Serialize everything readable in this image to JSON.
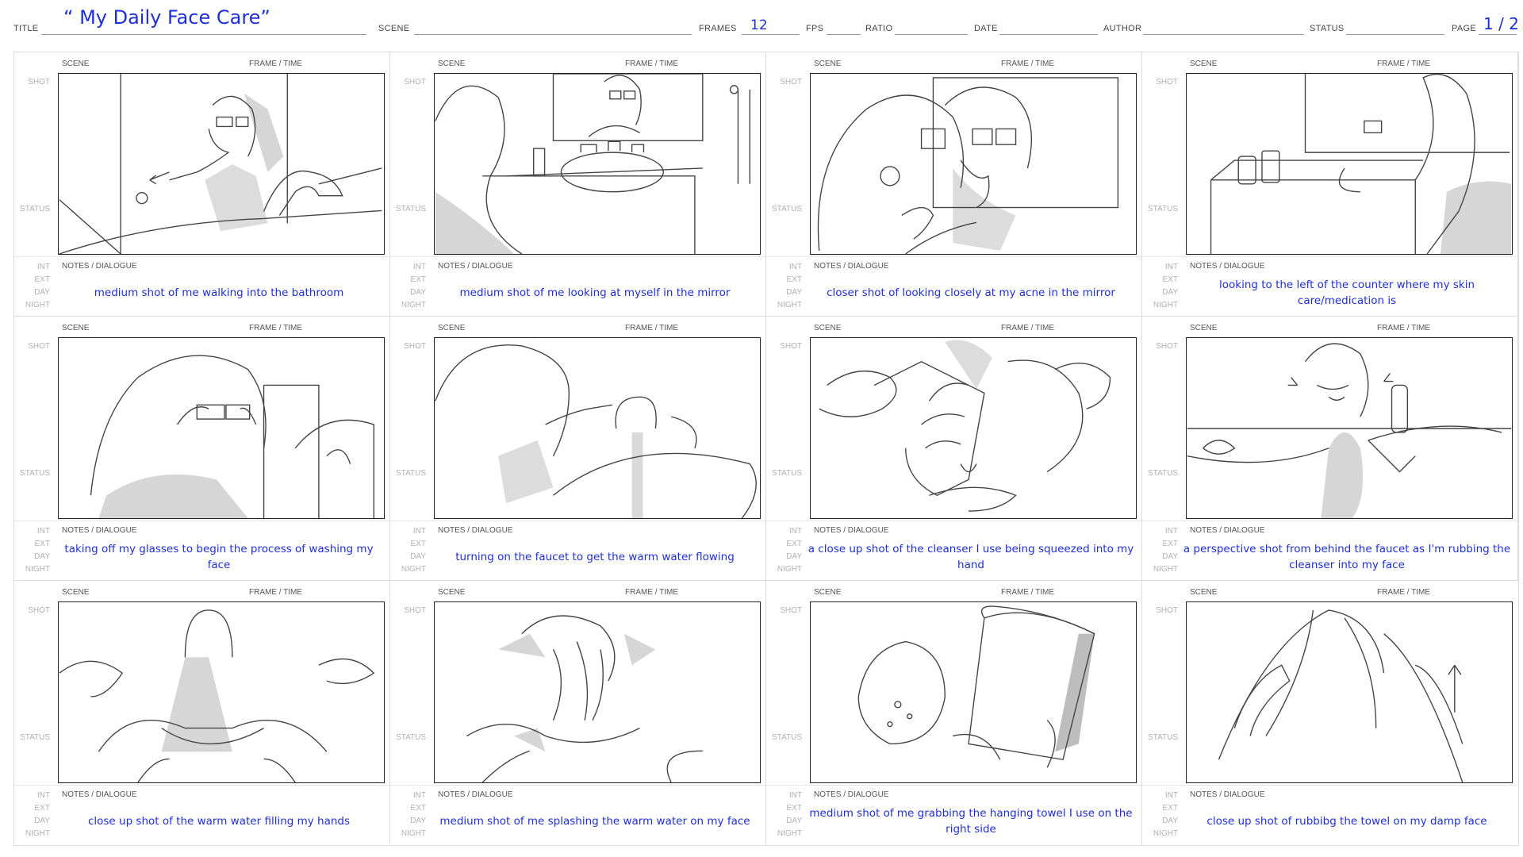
{
  "header": {
    "title_label": "TITLE",
    "title_value": "“ My Daily Face Care”",
    "scene_label": "SCENE",
    "frames_label": "FRAMES",
    "frames_value": "12",
    "fps_label": "FPS",
    "ratio_label": "RATIO",
    "date_label": "DATE",
    "author_label": "AUTHOR",
    "status_label": "STATUS",
    "page_label": "PAGE",
    "page_value": "1 / 2"
  },
  "labels": {
    "scene": "SCENE",
    "frame_time": "FRAME / TIME",
    "shot": "SHOT",
    "status": "STATUS",
    "int": "INT",
    "ext": "EXT",
    "day": "DAY",
    "night": "NIGHT",
    "notes": "NOTES / DIALOGUE"
  },
  "panels": [
    {
      "note": "medium shot of me walking into the bathroom",
      "sketch": "walking-into-bathroom"
    },
    {
      "note": "medium shot of me looking at myself in the mirror",
      "sketch": "looking-in-mirror"
    },
    {
      "note": "closer shot of looking closely at my acne in the mirror",
      "sketch": "acne-closeup"
    },
    {
      "note": "looking to the left of the counter where my skin care/medication is",
      "sketch": "counter-products"
    },
    {
      "note": "taking off my glasses to begin the process of washing my face",
      "sketch": "removing-glasses"
    },
    {
      "note": "turning on the faucet to get the warm water flowing",
      "sketch": "turning-faucet"
    },
    {
      "note": "a close up shot of the cleanser I use being squeezed into my hand",
      "sketch": "squeezing-cleanser"
    },
    {
      "note": "a perspective shot from behind the faucet as I'm rubbing the cleanser into my face",
      "sketch": "rubbing-cleanser"
    },
    {
      "note": "close up shot of the warm water filling my hands",
      "sketch": "water-in-hands"
    },
    {
      "note": "medium shot of me splashing the warm water on my face",
      "sketch": "splashing-water"
    },
    {
      "note": "medium shot of me grabbing the hanging towel I use on the right side",
      "sketch": "grabbing-towel"
    },
    {
      "note": "close up shot of rubbibg the towel on my damp face",
      "sketch": "towel-on-face"
    }
  ]
}
